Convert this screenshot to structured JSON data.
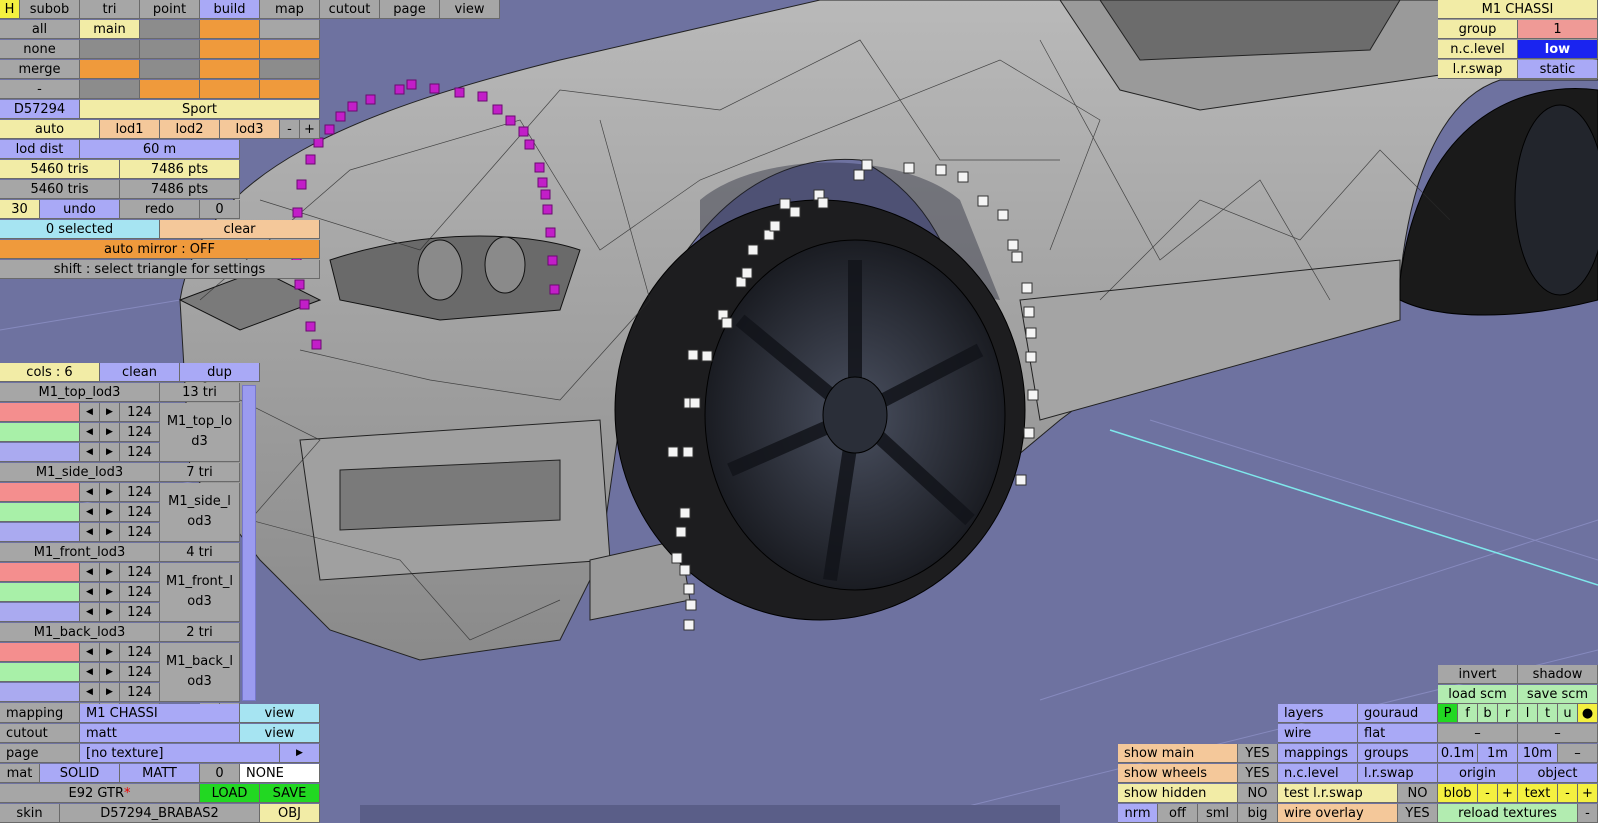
{
  "top_tabs": {
    "h": "H",
    "subob": "subob",
    "tri": "tri",
    "point": "point",
    "build": "build",
    "map": "map",
    "cutout": "cutout",
    "page": "page",
    "view": "view"
  },
  "select_rows": {
    "all": "all",
    "main": "main",
    "none": "none",
    "merge": "merge",
    "dash": "-"
  },
  "part": {
    "id": "D57294",
    "name": "Sport"
  },
  "lod": {
    "auto": "auto",
    "lod1": "lod1",
    "lod2": "lod2",
    "lod3": "lod3",
    "minus": "-",
    "plus": "+",
    "dist_label": "lod dist",
    "dist_value": "60 m"
  },
  "stats": {
    "tris1": "5460 tris",
    "pts1": "7486 pts",
    "tris2": "5460 tris",
    "pts2": "7486 pts"
  },
  "undo": {
    "count": "30",
    "undo": "undo",
    "redo": "redo",
    "redo_count": "0"
  },
  "selection": {
    "selected": "0 selected",
    "clear": "clear",
    "mirror": "auto mirror : OFF",
    "hint": "shift : select triangle for settings"
  },
  "cols": {
    "label": "cols : 6",
    "clean": "clean",
    "dup": "dup"
  },
  "lod_groups": [
    {
      "name": "M1_top_lod3",
      "tri": "13 tri",
      "v1": "124",
      "v2": "124",
      "v3": "124",
      "tex1": "M1_top_lo",
      "tex2": "d3"
    },
    {
      "name": "M1_side_lod3",
      "tri": "7 tri",
      "v1": "124",
      "v2": "124",
      "v3": "124",
      "tex1": "M1_side_l",
      "tex2": "od3"
    },
    {
      "name": "M1_front_lod3",
      "tri": "4 tri",
      "v1": "124",
      "v2": "124",
      "v3": "124",
      "tex1": "M1_front_l",
      "tex2": "od3"
    },
    {
      "name": "M1_back_lod3",
      "tri": "2 tri",
      "v1": "124",
      "v2": "124",
      "v3": "124",
      "tex1": "M1_back_l",
      "tex2": "od3"
    }
  ],
  "bottom_left": {
    "mapping_label": "mapping",
    "mapping_value": "M1 CHASSI",
    "view1": "view",
    "cutout_label": "cutout",
    "cutout_value": "matt",
    "view2": "view",
    "page_label": "page",
    "page_value": "[no texture]",
    "page_arrow": "▶",
    "mat": "mat",
    "solid": "SOLID",
    "matt": "MATT",
    "zero": "0",
    "none": "NONE",
    "file": "E92 GTR",
    "file_mark": "*",
    "load": "LOAD",
    "save": "SAVE",
    "skin_label": "skin",
    "skin_value": "D57294_BRABAS2",
    "obj": "OBJ"
  },
  "top_right": {
    "title": "M1 CHASSI",
    "group_label": "group",
    "group_value": "1",
    "nc_label": "n.c.level",
    "nc_value": "low",
    "lr_label": "l.r.swap",
    "lr_value": "static"
  },
  "bottom_right": {
    "invert": "invert",
    "shadow": "shadow",
    "load_scm": "load scm",
    "save_scm": "save scm",
    "letters": [
      "P",
      "f",
      "b",
      "r",
      "l",
      "t",
      "u",
      "●"
    ],
    "dash1": "–",
    "dash2": "–",
    "layers": "layers",
    "gouraud": "gouraud",
    "wire": "wire",
    "flat": "flat",
    "mappings": "mappings",
    "groups": "groups",
    "ncl": "n.c.level",
    "lrs": "l.r.swap",
    "test_lr": "test l.r.swap",
    "test_lr_val": "NO",
    "wire_overlay": "wire overlay",
    "wire_overlay_val": "YES",
    "d01": "0.1m",
    "d1": "1m",
    "d10": "10m",
    "dm": "–",
    "origin": "origin",
    "object": "object",
    "blob": "blob",
    "blob_m": "-",
    "blob_p": "+",
    "text": "text",
    "text_m": "-",
    "text_p": "+",
    "reload": "reload textures",
    "reload_m": "-"
  },
  "show_panel": {
    "main": "show main",
    "main_val": "YES",
    "wheels": "show wheels",
    "wheels_val": "YES",
    "hidden": "show hidden",
    "hidden_val": "NO",
    "nrm": "nrm",
    "off": "off",
    "sml": "sml",
    "big": "big"
  }
}
